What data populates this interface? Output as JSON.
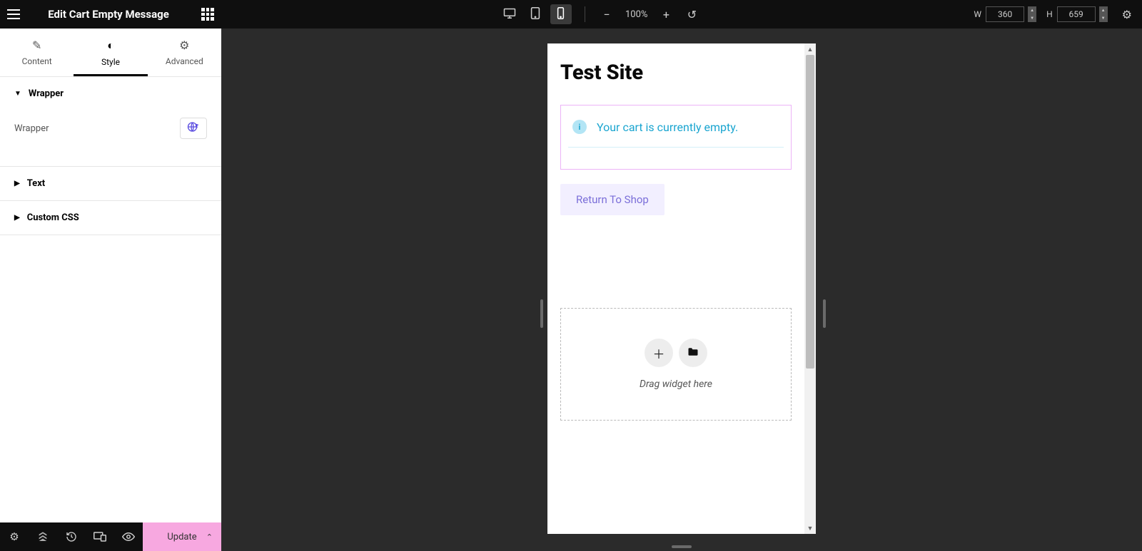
{
  "sidebar": {
    "title": "Edit Cart Empty Message",
    "tabs": {
      "content": "Content",
      "style": "Style",
      "advanced": "Advanced"
    },
    "sections": {
      "wrapper": {
        "title": "Wrapper",
        "control_label": "Wrapper"
      },
      "text": {
        "title": "Text"
      },
      "custom_css": {
        "title": "Custom CSS"
      }
    },
    "update_label": "Update"
  },
  "topbar": {
    "zoom": "100%",
    "width_label": "W",
    "width_value": "360",
    "height_label": "H",
    "height_value": "659"
  },
  "preview": {
    "site_title": "Test Site",
    "empty_cart_msg": "Your cart is currently empty.",
    "return_btn": "Return To Shop",
    "drag_hint": "Drag widget here"
  }
}
